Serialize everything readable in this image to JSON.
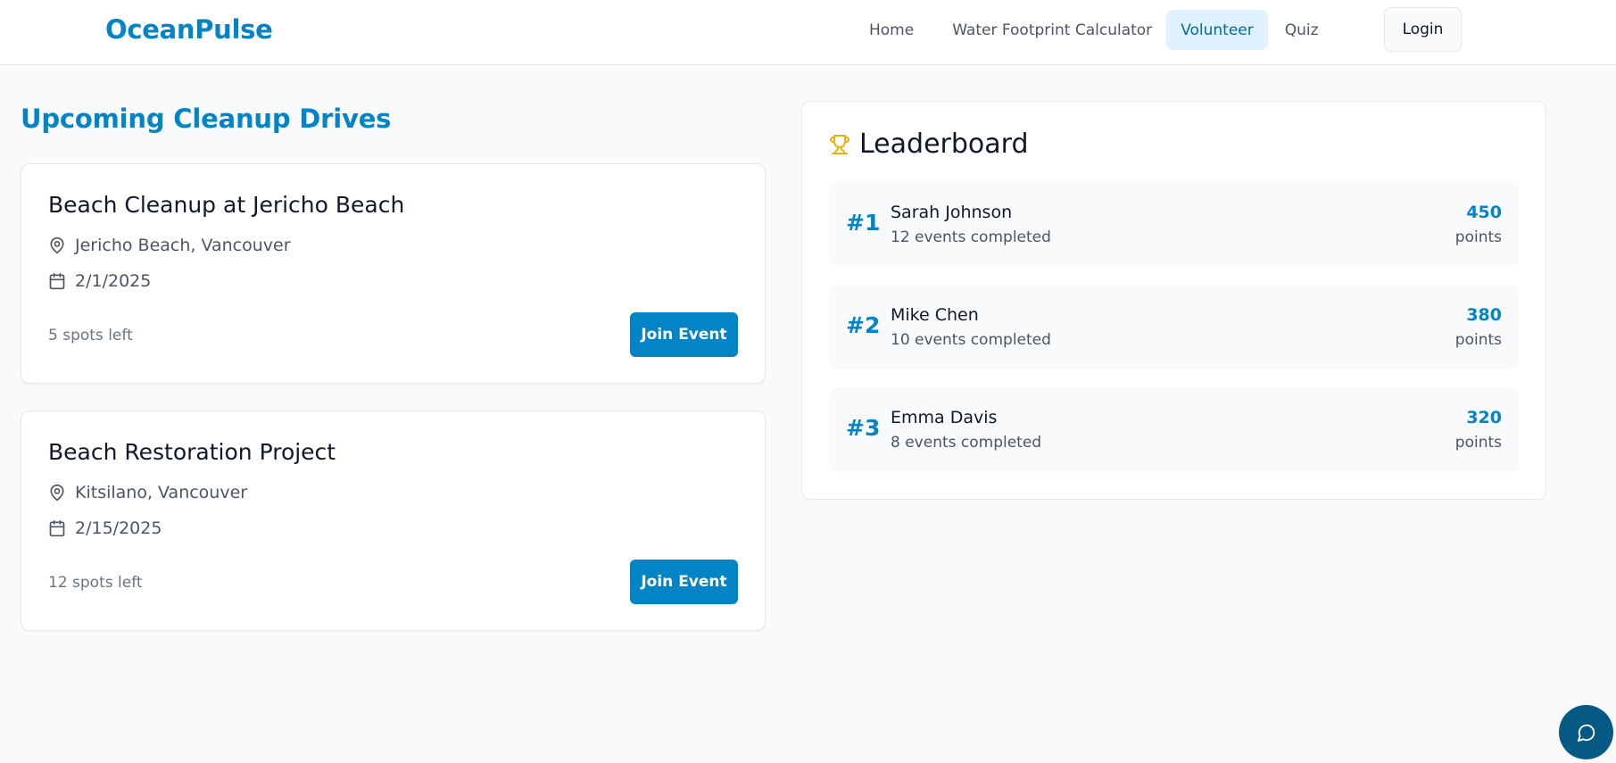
{
  "header": {
    "brand": "OceanPulse",
    "nav": [
      {
        "label": "Home",
        "active": false
      },
      {
        "label": "Water Footprint Calculator",
        "active": false
      },
      {
        "label": "Volunteer",
        "active": true
      },
      {
        "label": "Quiz",
        "active": false
      }
    ],
    "login_label": "Login"
  },
  "main": {
    "section_title": "Upcoming Cleanup Drives",
    "events": [
      {
        "title": "Beach Cleanup at Jericho Beach",
        "location": "Jericho Beach, Vancouver",
        "date": "2/1/2025",
        "spots": "5 spots left",
        "button": "Join Event"
      },
      {
        "title": "Beach Restoration Project",
        "location": "Kitsilano, Vancouver",
        "date": "2/15/2025",
        "spots": "12 spots left",
        "button": "Join Event"
      }
    ]
  },
  "leaderboard": {
    "title": "Leaderboard",
    "icon": "trophy-icon",
    "entries": [
      {
        "rank": "#1",
        "name": "Sarah Johnson",
        "events": "12 events completed",
        "points": "450",
        "points_label": "points"
      },
      {
        "rank": "#2",
        "name": "Mike Chen",
        "events": "10 events completed",
        "points": "380",
        "points_label": "points"
      },
      {
        "rank": "#3",
        "name": "Emma Davis",
        "events": "8 events completed",
        "points": "320",
        "points_label": "points"
      }
    ]
  },
  "chat": {
    "icon": "chat-bubble-icon"
  },
  "colors": {
    "accent": "#0284c7",
    "accent_dark": "#075985",
    "active_nav_bg": "#e0f2fe",
    "trophy": "#eab308",
    "page_bg": "#f8fafc"
  }
}
